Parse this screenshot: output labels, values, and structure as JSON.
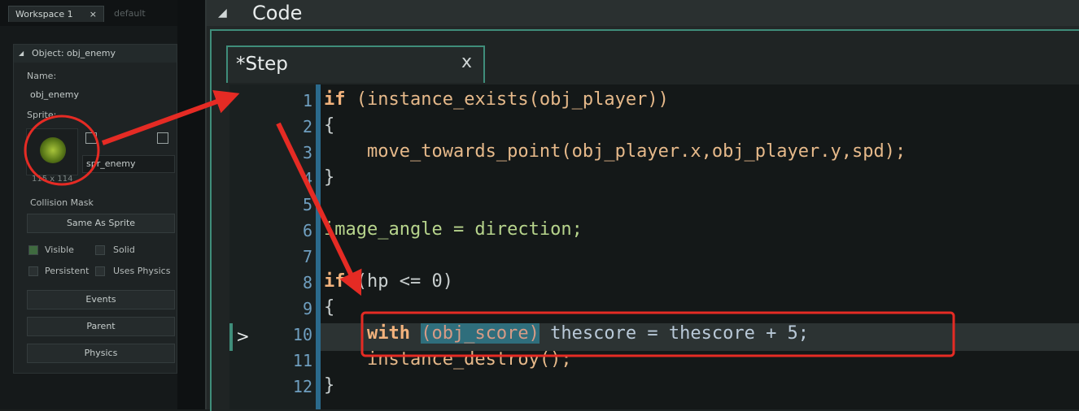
{
  "workspace": {
    "tabs": [
      {
        "label": "Workspace 1",
        "close": "×"
      },
      {
        "label": "default"
      }
    ]
  },
  "object_panel": {
    "title": "Object: obj_enemy",
    "name_label": "Name:",
    "name_value": "obj_enemy",
    "sprite_label": "Sprite:",
    "sprite_value": "spr_enemy",
    "sprite_size": "115 x 114",
    "collision_mask_label": "Collision Mask",
    "collision_mask_value": "Same As Sprite",
    "checkboxes": [
      {
        "label": "Visible",
        "checked": true
      },
      {
        "label": "Solid",
        "checked": false
      },
      {
        "label": "Persistent",
        "checked": false
      },
      {
        "label": "Uses Physics",
        "checked": false
      }
    ],
    "buttons": [
      "Events",
      "Parent",
      "Physics"
    ]
  },
  "code_window": {
    "title": "Code",
    "tab_label": "*Step",
    "tab_close": "x",
    "lines": [
      "1",
      "2",
      "3",
      "4",
      "5",
      "6",
      "7",
      "8",
      "9",
      "10",
      "11",
      "12"
    ],
    "code": {
      "l1_kw": "if",
      "l1_rest": " (instance_exists(obj_player))",
      "l2": "{",
      "l3": "    move_towards_point(obj_player.x,obj_player.y,spd);",
      "l4": "}",
      "l6": "image_angle = direction;",
      "l8_kw": "if",
      "l8_rest": " (hp <= 0)",
      "l9": "{",
      "l10_kw": "with",
      "l10_sel": "(obj_score)",
      "l10_rest": " thescore = thescore + 5;",
      "l11": "    instance_destroy();",
      "l12": "}"
    },
    "current_line_marker": ">"
  },
  "colors": {
    "accent_teal": "#3f8d7a",
    "annotation_red": "#e52b24",
    "keyword": "#f3b37d",
    "number": "#ff8c5a"
  }
}
